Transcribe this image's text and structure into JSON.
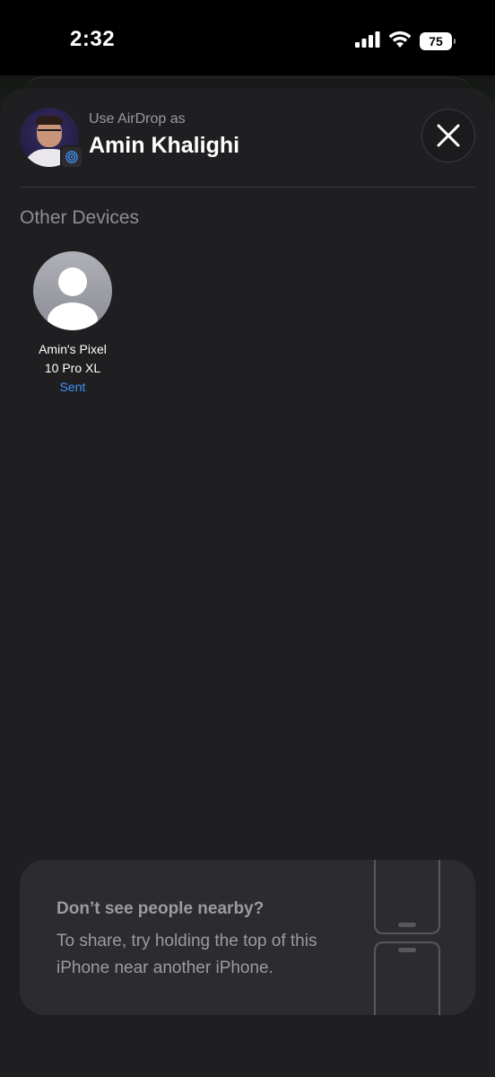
{
  "status_bar": {
    "time": "2:32",
    "battery": "75"
  },
  "header": {
    "use_airdrop_label": "Use AirDrop as",
    "user_name": "Amin Khalighi"
  },
  "section": {
    "title": "Other Devices"
  },
  "devices": [
    {
      "name_line1": "Amin's Pixel",
      "name_line2": "10 Pro XL",
      "status": "Sent"
    }
  ],
  "tip": {
    "title": "Don’t see people nearby?",
    "body": "To share, try holding the top of this iPhone near another iPhone."
  },
  "colors": {
    "sheet_bg": "#1f1f21",
    "accent_blue": "#3e8ff5",
    "secondary_text": "#9a9aa0"
  },
  "icons": {
    "close": "close-icon",
    "airdrop": "airdrop-icon",
    "signal": "cellular-signal-icon",
    "wifi": "wifi-icon",
    "battery": "battery-icon"
  }
}
